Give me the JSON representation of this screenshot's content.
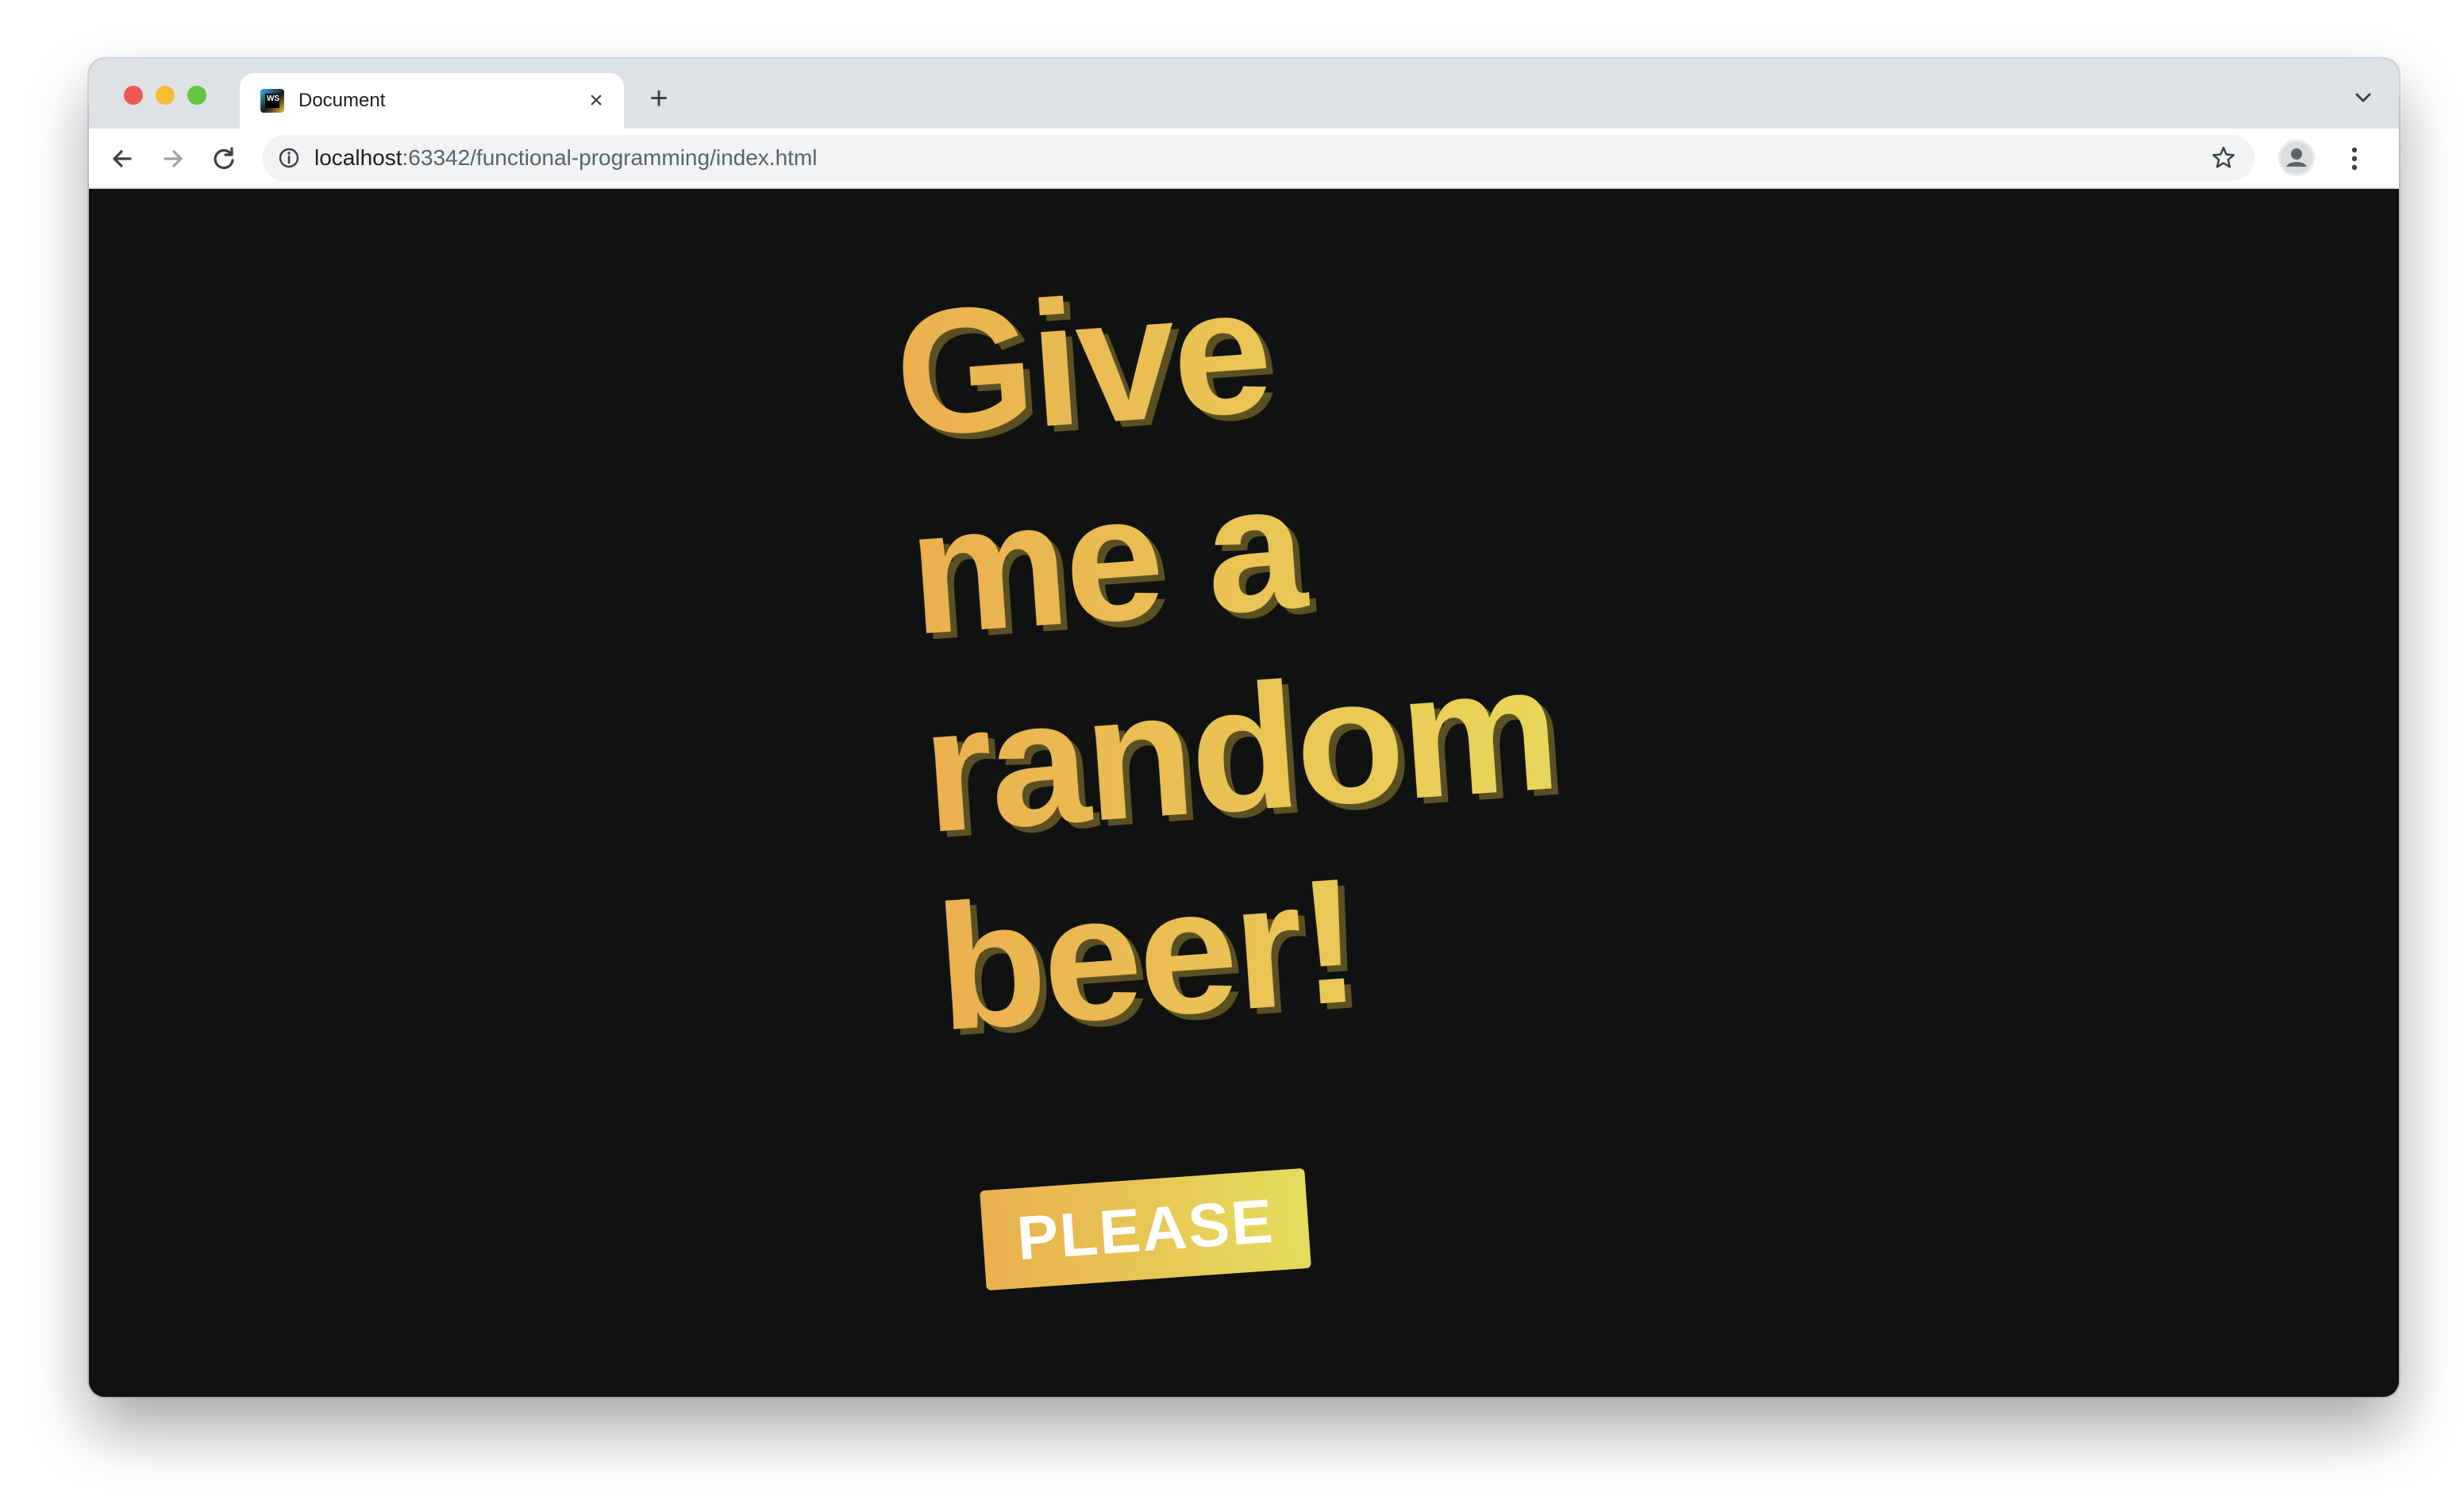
{
  "browser": {
    "tab": {
      "title": "Document",
      "favicon_text": "WS"
    },
    "address_bar": {
      "host": "localhost",
      "path": ":63342/functional-programming/index.html"
    }
  },
  "page": {
    "headline_lines": [
      "Give",
      "me a",
      "random",
      "beer!"
    ],
    "button_label": "PLEASE"
  },
  "colors": {
    "page_background": "#101211",
    "gradient_start": "#ebb04f",
    "gradient_end": "#e9d65a",
    "text_shadow": "#5a5023",
    "button_text": "#ffffff"
  },
  "icons": {
    "traffic_lights": [
      "close-window-icon",
      "minimize-window-icon",
      "zoom-window-icon"
    ],
    "tab_close": "close-icon",
    "new_tab": "plus-icon",
    "tab_list": "chevron-down-icon",
    "back": "arrow-left-icon",
    "forward": "arrow-right-icon",
    "reload": "reload-icon",
    "site_info": "info-icon",
    "bookmark": "star-icon",
    "profile": "person-icon",
    "menu": "kebab-menu-icon"
  }
}
